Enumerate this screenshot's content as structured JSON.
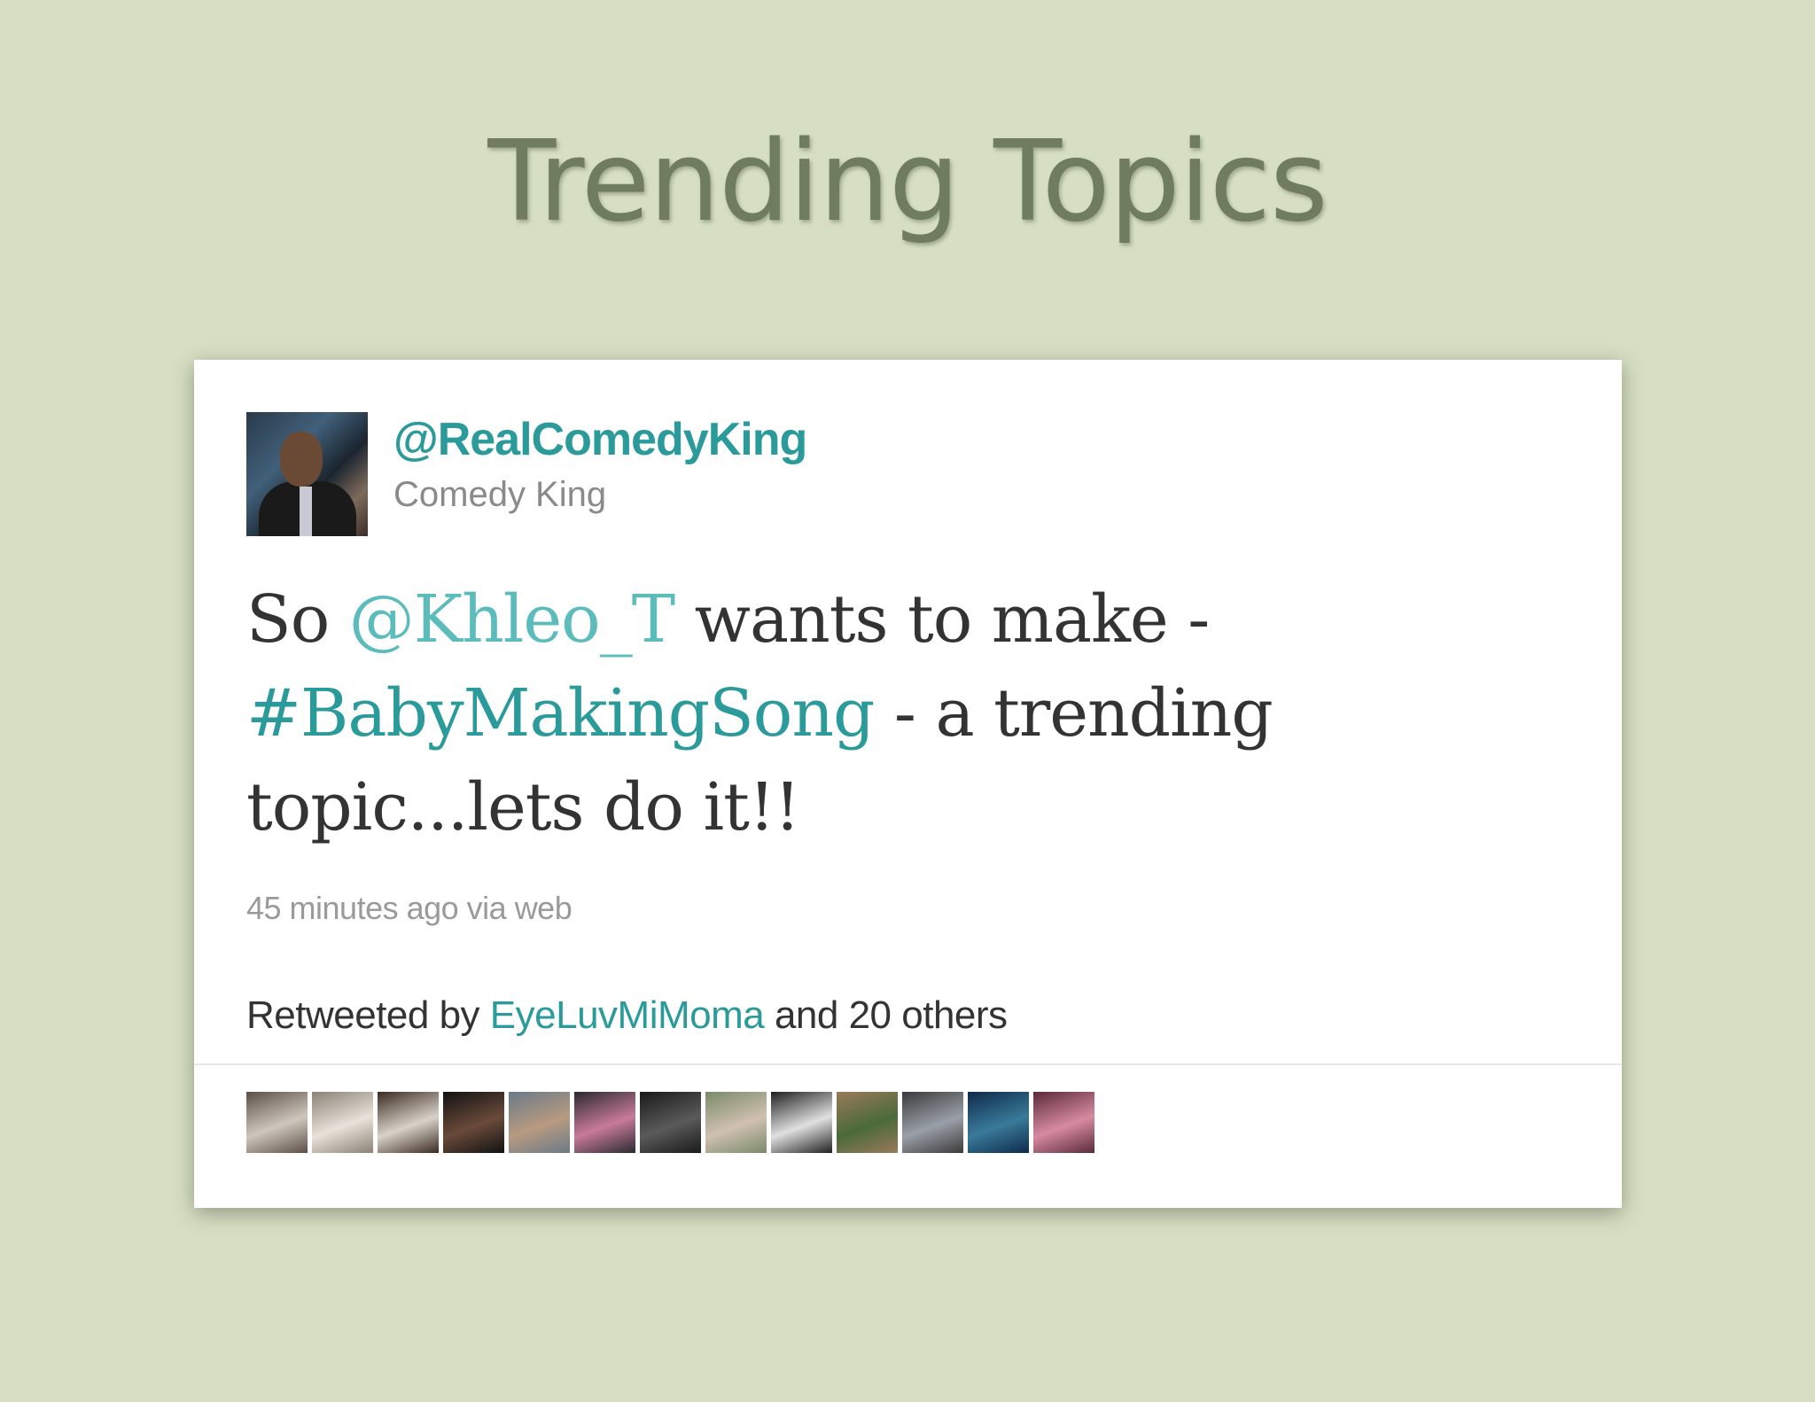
{
  "slide": {
    "title": "Trending Topics"
  },
  "tweet": {
    "username": "@RealComedyKing",
    "display_name": "Comedy King",
    "text_parts": {
      "p1": "So ",
      "mention": "@Khleo_T",
      "p2": " wants to make - ",
      "hashtag": "#BabyMakingSong",
      "p3": " - a trending topic...lets do it!!"
    },
    "meta": "45 minutes ago via web",
    "retweet": {
      "prefix": "Retweeted by ",
      "user": "EyeLuvMiMoma",
      "suffix": " and 20 others"
    },
    "retweeter_avatars": [
      {
        "name": "retweeter-avatar-1",
        "colors": [
          "#5b5048",
          "#cfc6bd"
        ]
      },
      {
        "name": "retweeter-avatar-2",
        "colors": [
          "#8a8276",
          "#e8e2da"
        ]
      },
      {
        "name": "retweeter-avatar-3",
        "colors": [
          "#3a2a22",
          "#d9d2c8"
        ]
      },
      {
        "name": "retweeter-avatar-4",
        "colors": [
          "#121212",
          "#6a4a3a"
        ]
      },
      {
        "name": "retweeter-avatar-5",
        "colors": [
          "#6a7a88",
          "#b89a80"
        ]
      },
      {
        "name": "retweeter-avatar-6",
        "colors": [
          "#2a2a30",
          "#c87a9a"
        ]
      },
      {
        "name": "retweeter-avatar-7",
        "colors": [
          "#1a1a1a",
          "#5a5a5a"
        ]
      },
      {
        "name": "retweeter-avatar-8",
        "colors": [
          "#7a8a6a",
          "#d0c0b0"
        ]
      },
      {
        "name": "retweeter-avatar-9",
        "colors": [
          "#202020",
          "#e0e0e0"
        ]
      },
      {
        "name": "retweeter-avatar-10",
        "colors": [
          "#9a7a5a",
          "#4a6a3a"
        ]
      },
      {
        "name": "retweeter-avatar-11",
        "colors": [
          "#3a3a3a",
          "#9aa0a8"
        ]
      },
      {
        "name": "retweeter-avatar-12",
        "colors": [
          "#0e2a4a",
          "#3a7a9a"
        ]
      },
      {
        "name": "retweeter-avatar-13",
        "colors": [
          "#5a2a3a",
          "#d88aa0"
        ]
      }
    ]
  }
}
